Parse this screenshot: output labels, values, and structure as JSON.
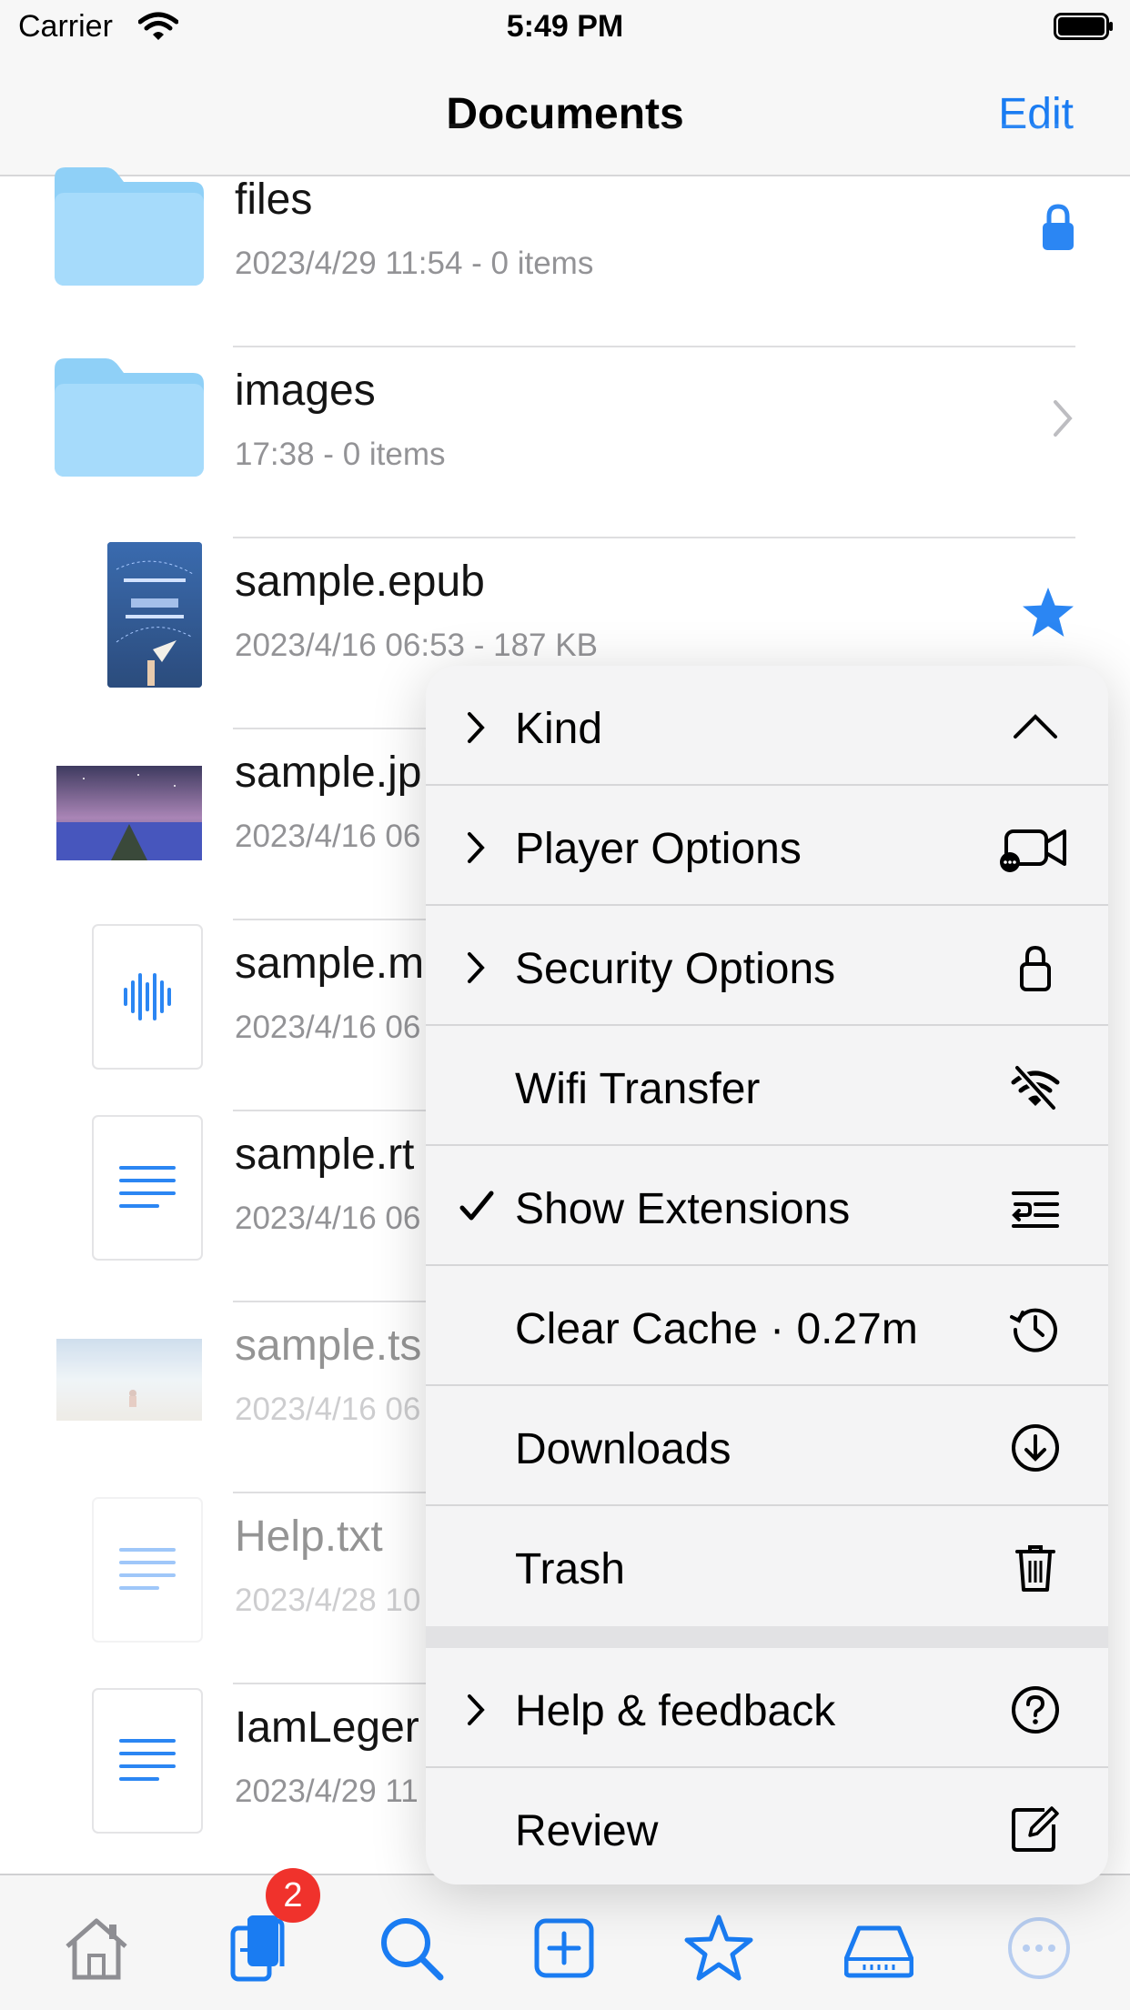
{
  "status_bar": {
    "carrier": "Carrier",
    "time": "5:49 PM"
  },
  "nav": {
    "title": "Documents",
    "edit_label": "Edit"
  },
  "files": [
    {
      "name": "files",
      "meta": "2023/4/29 11:54 - 0 items",
      "kind": "folder",
      "accessory": "lock-icon"
    },
    {
      "name": "images",
      "meta": "17:38 - 0 items",
      "kind": "folder",
      "accessory": "chevron-right-icon"
    },
    {
      "name": "sample.epub",
      "meta": "2023/4/16 06:53 - 187 KB",
      "kind": "epub",
      "accessory": "star-icon"
    },
    {
      "name": "sample.jp",
      "meta": "2023/4/16 06",
      "kind": "photo"
    },
    {
      "name": "sample.m",
      "meta": "2023/4/16 06",
      "kind": "audio"
    },
    {
      "name": "sample.rt",
      "meta": "2023/4/16 06",
      "kind": "text"
    },
    {
      "name": "sample.ts",
      "meta": "2023/4/16 06",
      "kind": "video",
      "faded": true
    },
    {
      "name": "Help.txt",
      "meta": "2023/4/28 10",
      "kind": "text",
      "faded": true
    },
    {
      "name": "IamLeger",
      "meta": "2023/4/29 11",
      "kind": "text"
    }
  ],
  "menu": {
    "items": [
      {
        "label": "Kind",
        "icon": "chevron-up-icon",
        "prefix": "chevron"
      },
      {
        "label": "Player Options",
        "icon": "video-camera-icon",
        "prefix": "chevron"
      },
      {
        "label": "Security Options",
        "icon": "lock-outline-icon",
        "prefix": "chevron"
      },
      {
        "label": "Wifi Transfer",
        "icon": "wifi-slash-icon",
        "prefix": "none"
      },
      {
        "label": "Show Extensions",
        "icon": "text-list-icon",
        "prefix": "check"
      },
      {
        "label": "Clear Cache · 0.27m",
        "icon": "history-clock-icon",
        "prefix": "none"
      },
      {
        "label": "Downloads",
        "icon": "download-circle-icon",
        "prefix": "none"
      },
      {
        "label": "Trash",
        "icon": "trash-icon",
        "prefix": "none"
      },
      {
        "label": "Help & feedback",
        "icon": "question-circle-icon",
        "prefix": "chevron"
      },
      {
        "label": "Review",
        "icon": "compose-icon",
        "prefix": "none"
      }
    ]
  },
  "tabbar": {
    "badge_count": "2",
    "tabs": [
      "home-icon",
      "documents-icon",
      "search-icon",
      "add-icon",
      "favorites-star-icon",
      "drive-icon",
      "more-icon"
    ]
  },
  "colors": {
    "accent": "#1a7cf2",
    "folder": "#86cdf7",
    "badge": "#f0322c"
  }
}
